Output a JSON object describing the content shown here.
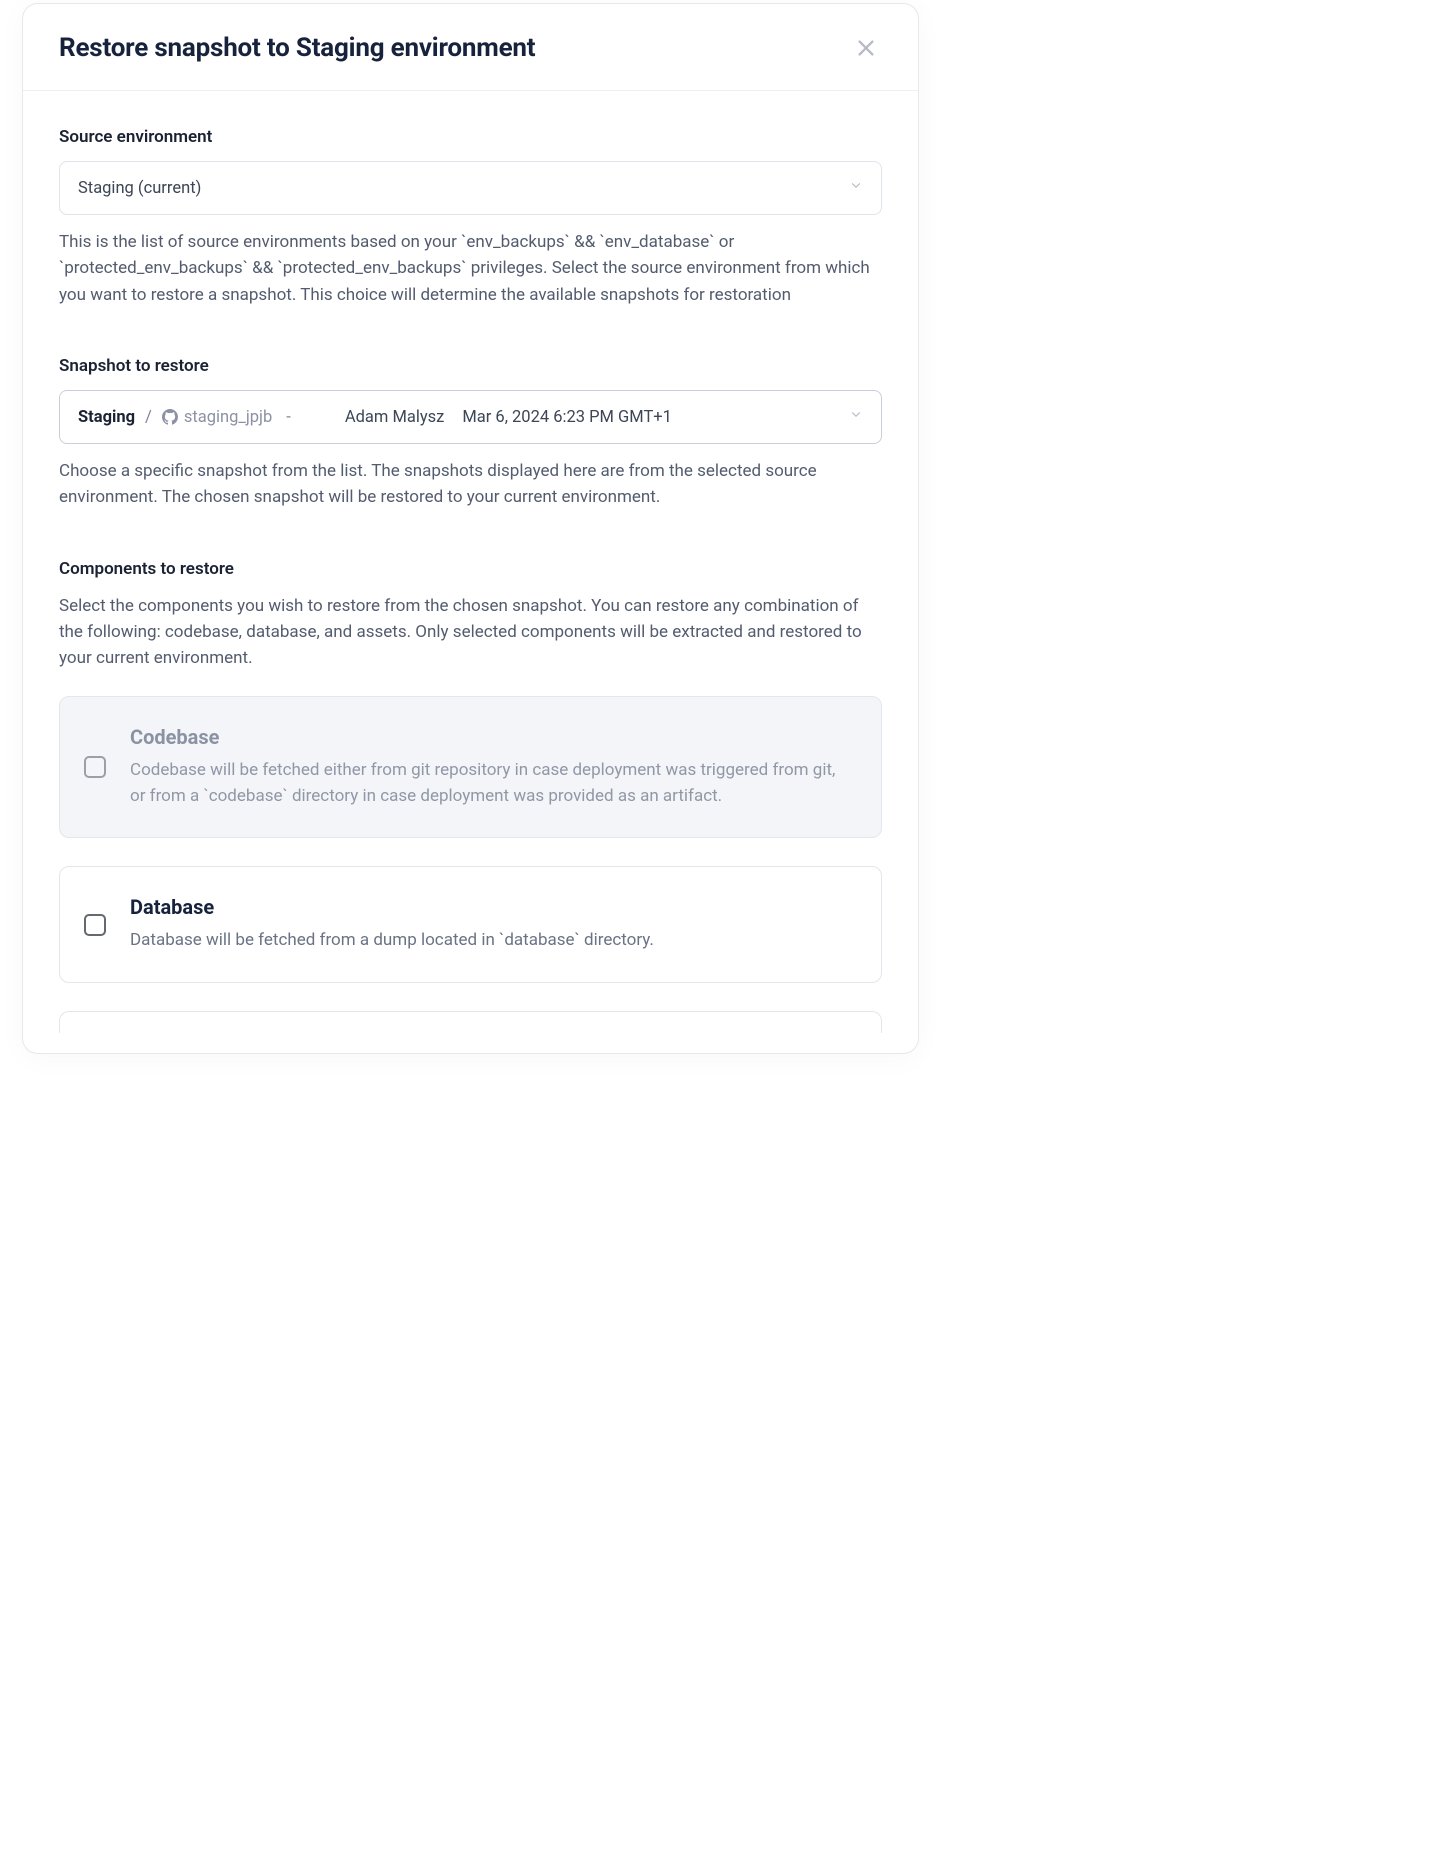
{
  "modal": {
    "title": "Restore snapshot to Staging environment"
  },
  "source_env": {
    "label": "Source environment",
    "selected": "Staging (current)",
    "help": "This is the list of source environments based on your `env_backups` && `env_database` or `protected_env_backups` && `protected_env_backups` privileges. Select the source environment from which you want to restore a snapshot. This choice will determine the available snapshots for restoration"
  },
  "snapshot": {
    "label": "Snapshot to restore",
    "selected": {
      "env": "Staging",
      "branch": "staging_jpjb",
      "dash": "-",
      "author": "Adam Malysz",
      "timestamp": "Mar 6, 2024 6:23 PM GMT+1"
    },
    "help": "Choose a specific snapshot from the list. The snapshots displayed here are from the selected source environment. The chosen snapshot will be restored to your current environment."
  },
  "components": {
    "label": "Components to restore",
    "help": "Select the components you wish to restore from the chosen snapshot. You can restore any combination of the following: codebase, database, and assets. Only selected components will be extracted and restored to your current environment.",
    "items": [
      {
        "title": "Codebase",
        "desc": "Codebase will be fetched either from git repository in case deployment was triggered from git, or from a `codebase` directory in case deployment was provided as an artifact.",
        "disabled": true
      },
      {
        "title": "Database",
        "desc": "Database will be fetched from a dump located in `database` directory.",
        "disabled": false
      }
    ]
  }
}
